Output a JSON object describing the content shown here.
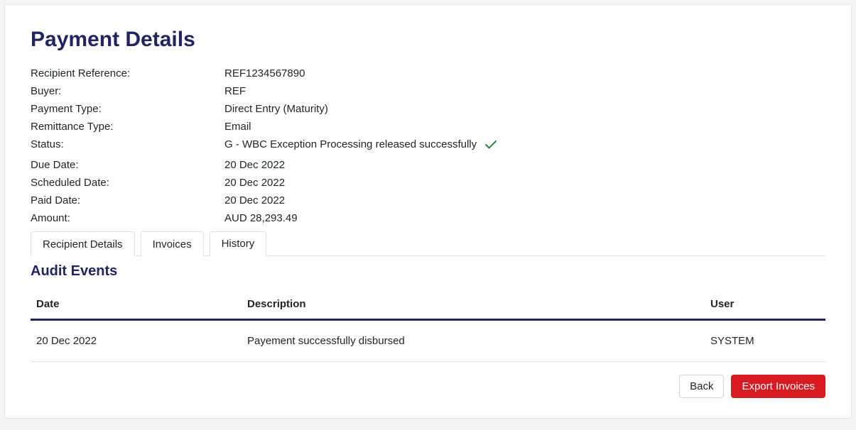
{
  "header": {
    "title": "Payment Details"
  },
  "details": {
    "recipient_reference": {
      "label": "Recipient Reference:",
      "value": "REF1234567890"
    },
    "buyer": {
      "label": "Buyer:",
      "value": "REF"
    },
    "payment_type": {
      "label": "Payment Type:",
      "value": "Direct Entry (Maturity)"
    },
    "remittance_type": {
      "label": "Remittance Type:",
      "value": "Email"
    },
    "status": {
      "label": "Status:",
      "value": "G - WBC Exception Processing released successfully"
    },
    "due_date": {
      "label": "Due Date:",
      "value": "20 Dec 2022"
    },
    "scheduled_date": {
      "label": "Scheduled Date:",
      "value": "20 Dec 2022"
    },
    "paid_date": {
      "label": "Paid Date:",
      "value": "20 Dec 2022"
    },
    "amount": {
      "label": "Amount:",
      "value": "AUD 28,293.49"
    }
  },
  "tabs": {
    "recipient_details": "Recipient Details",
    "invoices": "Invoices",
    "history": "History",
    "active": "history"
  },
  "audit": {
    "heading": "Audit Events",
    "columns": {
      "date": "Date",
      "description": "Description",
      "user": "User"
    },
    "rows": [
      {
        "date": "20 Dec 2022",
        "description": "Payement successfully disbursed",
        "user": "SYSTEM"
      }
    ]
  },
  "actions": {
    "back": "Back",
    "export_invoices": "Export Invoices"
  }
}
